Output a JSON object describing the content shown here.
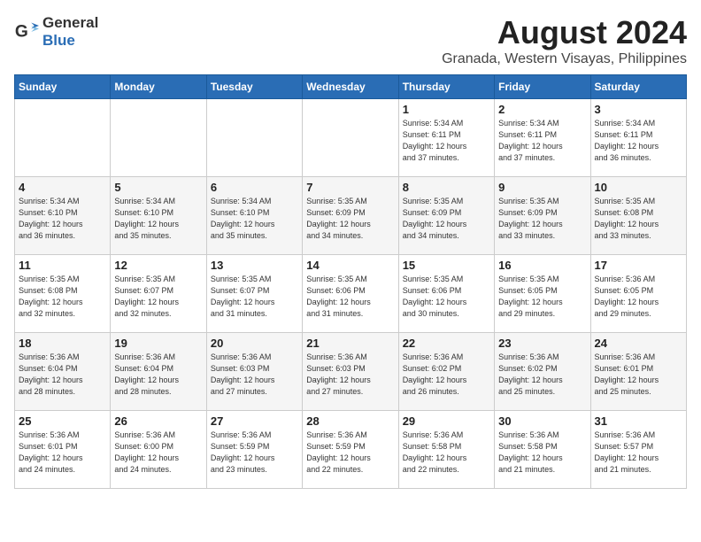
{
  "header": {
    "logo_general": "General",
    "logo_blue": "Blue",
    "month_year": "August 2024",
    "location": "Granada, Western Visayas, Philippines"
  },
  "days_of_week": [
    "Sunday",
    "Monday",
    "Tuesday",
    "Wednesday",
    "Thursday",
    "Friday",
    "Saturday"
  ],
  "weeks": [
    [
      {
        "day": "",
        "info": ""
      },
      {
        "day": "",
        "info": ""
      },
      {
        "day": "",
        "info": ""
      },
      {
        "day": "",
        "info": ""
      },
      {
        "day": "1",
        "info": "Sunrise: 5:34 AM\nSunset: 6:11 PM\nDaylight: 12 hours\nand 37 minutes."
      },
      {
        "day": "2",
        "info": "Sunrise: 5:34 AM\nSunset: 6:11 PM\nDaylight: 12 hours\nand 37 minutes."
      },
      {
        "day": "3",
        "info": "Sunrise: 5:34 AM\nSunset: 6:11 PM\nDaylight: 12 hours\nand 36 minutes."
      }
    ],
    [
      {
        "day": "4",
        "info": "Sunrise: 5:34 AM\nSunset: 6:10 PM\nDaylight: 12 hours\nand 36 minutes."
      },
      {
        "day": "5",
        "info": "Sunrise: 5:34 AM\nSunset: 6:10 PM\nDaylight: 12 hours\nand 35 minutes."
      },
      {
        "day": "6",
        "info": "Sunrise: 5:34 AM\nSunset: 6:10 PM\nDaylight: 12 hours\nand 35 minutes."
      },
      {
        "day": "7",
        "info": "Sunrise: 5:35 AM\nSunset: 6:09 PM\nDaylight: 12 hours\nand 34 minutes."
      },
      {
        "day": "8",
        "info": "Sunrise: 5:35 AM\nSunset: 6:09 PM\nDaylight: 12 hours\nand 34 minutes."
      },
      {
        "day": "9",
        "info": "Sunrise: 5:35 AM\nSunset: 6:09 PM\nDaylight: 12 hours\nand 33 minutes."
      },
      {
        "day": "10",
        "info": "Sunrise: 5:35 AM\nSunset: 6:08 PM\nDaylight: 12 hours\nand 33 minutes."
      }
    ],
    [
      {
        "day": "11",
        "info": "Sunrise: 5:35 AM\nSunset: 6:08 PM\nDaylight: 12 hours\nand 32 minutes."
      },
      {
        "day": "12",
        "info": "Sunrise: 5:35 AM\nSunset: 6:07 PM\nDaylight: 12 hours\nand 32 minutes."
      },
      {
        "day": "13",
        "info": "Sunrise: 5:35 AM\nSunset: 6:07 PM\nDaylight: 12 hours\nand 31 minutes."
      },
      {
        "day": "14",
        "info": "Sunrise: 5:35 AM\nSunset: 6:06 PM\nDaylight: 12 hours\nand 31 minutes."
      },
      {
        "day": "15",
        "info": "Sunrise: 5:35 AM\nSunset: 6:06 PM\nDaylight: 12 hours\nand 30 minutes."
      },
      {
        "day": "16",
        "info": "Sunrise: 5:35 AM\nSunset: 6:05 PM\nDaylight: 12 hours\nand 29 minutes."
      },
      {
        "day": "17",
        "info": "Sunrise: 5:36 AM\nSunset: 6:05 PM\nDaylight: 12 hours\nand 29 minutes."
      }
    ],
    [
      {
        "day": "18",
        "info": "Sunrise: 5:36 AM\nSunset: 6:04 PM\nDaylight: 12 hours\nand 28 minutes."
      },
      {
        "day": "19",
        "info": "Sunrise: 5:36 AM\nSunset: 6:04 PM\nDaylight: 12 hours\nand 28 minutes."
      },
      {
        "day": "20",
        "info": "Sunrise: 5:36 AM\nSunset: 6:03 PM\nDaylight: 12 hours\nand 27 minutes."
      },
      {
        "day": "21",
        "info": "Sunrise: 5:36 AM\nSunset: 6:03 PM\nDaylight: 12 hours\nand 27 minutes."
      },
      {
        "day": "22",
        "info": "Sunrise: 5:36 AM\nSunset: 6:02 PM\nDaylight: 12 hours\nand 26 minutes."
      },
      {
        "day": "23",
        "info": "Sunrise: 5:36 AM\nSunset: 6:02 PM\nDaylight: 12 hours\nand 25 minutes."
      },
      {
        "day": "24",
        "info": "Sunrise: 5:36 AM\nSunset: 6:01 PM\nDaylight: 12 hours\nand 25 minutes."
      }
    ],
    [
      {
        "day": "25",
        "info": "Sunrise: 5:36 AM\nSunset: 6:01 PM\nDaylight: 12 hours\nand 24 minutes."
      },
      {
        "day": "26",
        "info": "Sunrise: 5:36 AM\nSunset: 6:00 PM\nDaylight: 12 hours\nand 24 minutes."
      },
      {
        "day": "27",
        "info": "Sunrise: 5:36 AM\nSunset: 5:59 PM\nDaylight: 12 hours\nand 23 minutes."
      },
      {
        "day": "28",
        "info": "Sunrise: 5:36 AM\nSunset: 5:59 PM\nDaylight: 12 hours\nand 22 minutes."
      },
      {
        "day": "29",
        "info": "Sunrise: 5:36 AM\nSunset: 5:58 PM\nDaylight: 12 hours\nand 22 minutes."
      },
      {
        "day": "30",
        "info": "Sunrise: 5:36 AM\nSunset: 5:58 PM\nDaylight: 12 hours\nand 21 minutes."
      },
      {
        "day": "31",
        "info": "Sunrise: 5:36 AM\nSunset: 5:57 PM\nDaylight: 12 hours\nand 21 minutes."
      }
    ]
  ]
}
